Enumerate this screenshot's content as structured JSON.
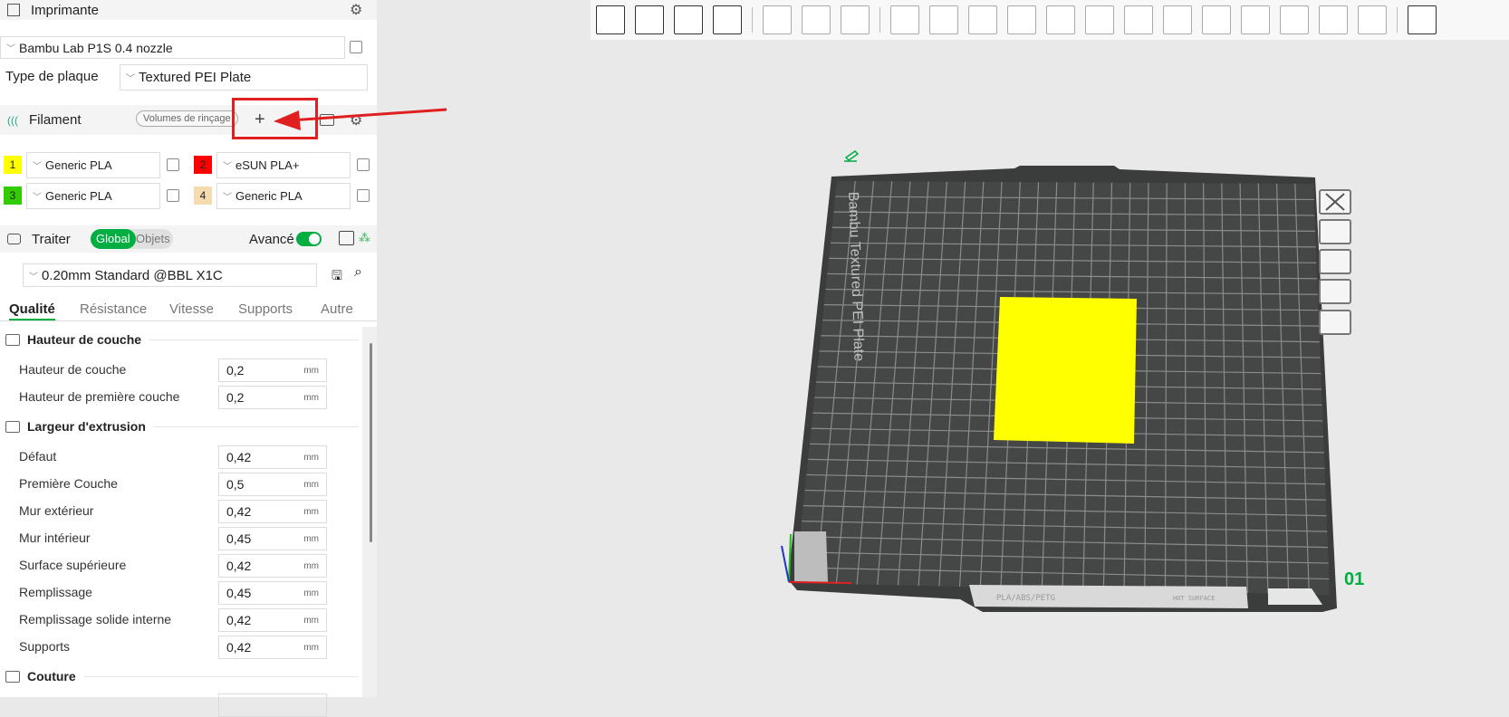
{
  "printer": {
    "title": "Imprimante",
    "preset": "Bambu Lab P1S 0.4 nozzle",
    "plate_label": "Type de plaque",
    "plate_value": "Textured PEI Plate"
  },
  "filament": {
    "title": "Filament",
    "flush_button": "Volumes de rinçage",
    "add_button": "+",
    "items": [
      {
        "num": "1",
        "color": "#ffff00",
        "name": "Generic PLA"
      },
      {
        "num": "2",
        "color": "#ff0000",
        "name": "eSUN PLA+"
      },
      {
        "num": "3",
        "color": "#33cc00",
        "name": "Generic PLA"
      },
      {
        "num": "4",
        "color": "#f5dcb0",
        "name": "Generic PLA"
      }
    ]
  },
  "process": {
    "title": "Traiter",
    "global": "Global",
    "objects": "Objets",
    "advanced": "Avancé",
    "advanced_on": true,
    "preset": "0.20mm Standard @BBL X1C",
    "tabs": [
      "Qualité",
      "Résistance",
      "Vitesse",
      "Supports",
      "Autre"
    ],
    "active_tab": "Qualité"
  },
  "sections": {
    "layer_height": "Hauteur de couche",
    "line_width": "Largeur d'extrusion",
    "seam": "Couture"
  },
  "unit": "mm",
  "rows": [
    {
      "label": "Hauteur de couche",
      "value": "0,2"
    },
    {
      "label": "Hauteur de première couche",
      "value": "0,2"
    },
    {
      "label": "Défaut",
      "value": "0,42"
    },
    {
      "label": "Première Couche",
      "value": "0,5"
    },
    {
      "label": "Mur extérieur",
      "value": "0,42"
    },
    {
      "label": "Mur intérieur",
      "value": "0,45"
    },
    {
      "label": "Surface supérieure",
      "value": "0,42"
    },
    {
      "label": "Remplissage",
      "value": "0,45"
    },
    {
      "label": "Remplissage solide interne",
      "value": "0,42"
    },
    {
      "label": "Supports",
      "value": "0,42"
    }
  ],
  "plate": {
    "name": "Bambu Textured PEI Plate",
    "number": "01",
    "bed_label": "PLA/ABS/PETG",
    "hot_label": "HOT SURFACE"
  },
  "colors": {
    "accent": "#00ae42",
    "annotation": "#e02020"
  }
}
